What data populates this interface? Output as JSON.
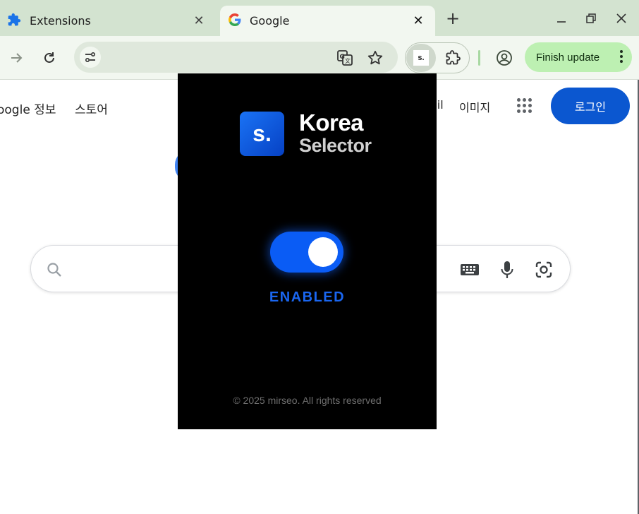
{
  "tabs": [
    {
      "label": "Extensions",
      "icon": "puzzle-icon"
    },
    {
      "label": "Google",
      "icon": "google-g-icon"
    }
  ],
  "toolbar": {
    "finish_update_label": "Finish update"
  },
  "page": {
    "nav_left": [
      "oogle 정보",
      "스토어"
    ],
    "nav_right": [
      "ail",
      "이미지"
    ],
    "login_label": "로그인"
  },
  "popup": {
    "logo_letter": "s.",
    "title": "Korea",
    "subtitle": "Selector",
    "toggle_state": "on",
    "status": "ENABLED",
    "footer": "© 2025 mirseo. All rights reserved"
  },
  "colors": {
    "accent": "#0a5cf5",
    "tabstrip": "#d3e3d0",
    "login": "#0b57d0",
    "finish_update": "#bdf0b2"
  }
}
